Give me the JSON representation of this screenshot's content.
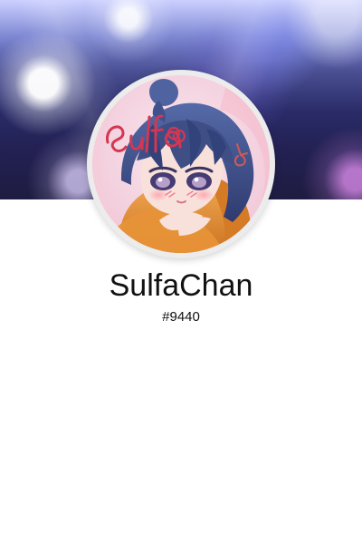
{
  "profile": {
    "username": "SulfaChan",
    "discriminator": "#9440",
    "avatar_text": "sulfa"
  },
  "colors": {
    "banner_primary": "#2a2c69",
    "avatar_ring": "#ececec",
    "avatar_bg": "#f6d9e6",
    "hair": "#3f4f86",
    "hoodie": "#dc8a2c",
    "script_red": "#d43752"
  }
}
